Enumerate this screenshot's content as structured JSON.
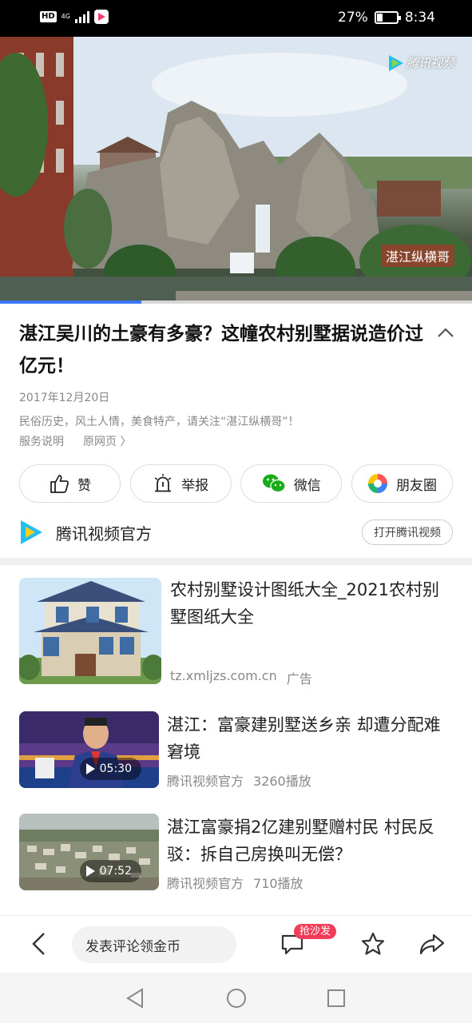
{
  "status_bar": {
    "hd": "HD",
    "network": "4G",
    "battery": "27%",
    "time": "8:34"
  },
  "video": {
    "watermark_brand": "腾讯视频",
    "watermark_channel": "湛江纵横哥",
    "progress": 0.3
  },
  "article": {
    "title": "湛江吴川的土豪有多豪？这幢农村别墅据说造价过亿元！",
    "date": "2017年12月20日",
    "description": "民俗历史，风土人情，美食特产，请关注“湛江纵横哥”！",
    "service_link": "服务说明",
    "original_link": "原网页 〉"
  },
  "actions": {
    "like": "赞",
    "report": "举报",
    "wechat": "微信",
    "moments": "朋友圈"
  },
  "source": {
    "name": "腾讯视频官方",
    "open_button": "打开腾讯视频"
  },
  "feed": [
    {
      "title": "农村别墅设计图纸大全_2021农村别墅图纸大全",
      "domain": "tz.xmljzs.com.cn",
      "tag": "广告"
    },
    {
      "title": "湛江：富豪建别墅送乡亲 却遭分配难窘境",
      "source": "腾讯视频官方",
      "plays": "3260播放",
      "duration": "05:30"
    },
    {
      "title": "湛江富豪捐2亿建别墅赠村民 村民反驳：拆自己房换叫无偿？",
      "source": "腾讯视频官方",
      "plays": "710播放",
      "duration": "07:52"
    }
  ],
  "bottom_bar": {
    "comment_placeholder": "发表评论领金币",
    "sofa_badge": "抢沙发"
  },
  "colors": {
    "accent_blue": "#3a77ff",
    "badge_red": "#f23d5a",
    "wechat_green": "#1aad19"
  }
}
